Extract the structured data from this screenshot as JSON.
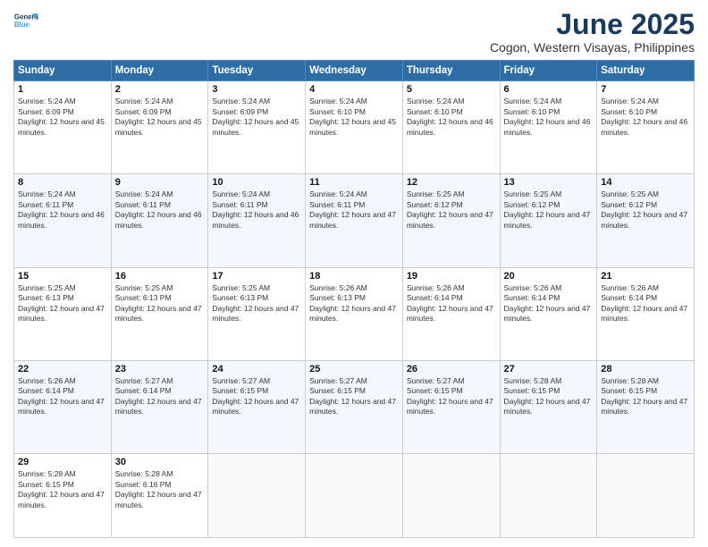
{
  "logo": {
    "line1": "General",
    "line2": "Blue"
  },
  "title": "June 2025",
  "subtitle": "Cogon, Western Visayas, Philippines",
  "weekdays": [
    "Sunday",
    "Monday",
    "Tuesday",
    "Wednesday",
    "Thursday",
    "Friday",
    "Saturday"
  ],
  "weeks": [
    [
      {
        "day": "1",
        "sunrise": "5:24 AM",
        "sunset": "6:09 PM",
        "daylight": "12 hours and 45 minutes."
      },
      {
        "day": "2",
        "sunrise": "5:24 AM",
        "sunset": "6:09 PM",
        "daylight": "12 hours and 45 minutes."
      },
      {
        "day": "3",
        "sunrise": "5:24 AM",
        "sunset": "6:09 PM",
        "daylight": "12 hours and 45 minutes."
      },
      {
        "day": "4",
        "sunrise": "5:24 AM",
        "sunset": "6:10 PM",
        "daylight": "12 hours and 45 minutes."
      },
      {
        "day": "5",
        "sunrise": "5:24 AM",
        "sunset": "6:10 PM",
        "daylight": "12 hours and 46 minutes."
      },
      {
        "day": "6",
        "sunrise": "5:24 AM",
        "sunset": "6:10 PM",
        "daylight": "12 hours and 46 minutes."
      },
      {
        "day": "7",
        "sunrise": "5:24 AM",
        "sunset": "6:10 PM",
        "daylight": "12 hours and 46 minutes."
      }
    ],
    [
      {
        "day": "8",
        "sunrise": "5:24 AM",
        "sunset": "6:11 PM",
        "daylight": "12 hours and 46 minutes."
      },
      {
        "day": "9",
        "sunrise": "5:24 AM",
        "sunset": "6:11 PM",
        "daylight": "12 hours and 46 minutes."
      },
      {
        "day": "10",
        "sunrise": "5:24 AM",
        "sunset": "6:11 PM",
        "daylight": "12 hours and 46 minutes."
      },
      {
        "day": "11",
        "sunrise": "5:24 AM",
        "sunset": "6:11 PM",
        "daylight": "12 hours and 47 minutes."
      },
      {
        "day": "12",
        "sunrise": "5:25 AM",
        "sunset": "6:12 PM",
        "daylight": "12 hours and 47 minutes."
      },
      {
        "day": "13",
        "sunrise": "5:25 AM",
        "sunset": "6:12 PM",
        "daylight": "12 hours and 47 minutes."
      },
      {
        "day": "14",
        "sunrise": "5:25 AM",
        "sunset": "6:12 PM",
        "daylight": "12 hours and 47 minutes."
      }
    ],
    [
      {
        "day": "15",
        "sunrise": "5:25 AM",
        "sunset": "6:13 PM",
        "daylight": "12 hours and 47 minutes."
      },
      {
        "day": "16",
        "sunrise": "5:25 AM",
        "sunset": "6:13 PM",
        "daylight": "12 hours and 47 minutes."
      },
      {
        "day": "17",
        "sunrise": "5:25 AM",
        "sunset": "6:13 PM",
        "daylight": "12 hours and 47 minutes."
      },
      {
        "day": "18",
        "sunrise": "5:26 AM",
        "sunset": "6:13 PM",
        "daylight": "12 hours and 47 minutes."
      },
      {
        "day": "19",
        "sunrise": "5:26 AM",
        "sunset": "6:14 PM",
        "daylight": "12 hours and 47 minutes."
      },
      {
        "day": "20",
        "sunrise": "5:26 AM",
        "sunset": "6:14 PM",
        "daylight": "12 hours and 47 minutes."
      },
      {
        "day": "21",
        "sunrise": "5:26 AM",
        "sunset": "6:14 PM",
        "daylight": "12 hours and 47 minutes."
      }
    ],
    [
      {
        "day": "22",
        "sunrise": "5:26 AM",
        "sunset": "6:14 PM",
        "daylight": "12 hours and 47 minutes."
      },
      {
        "day": "23",
        "sunrise": "5:27 AM",
        "sunset": "6:14 PM",
        "daylight": "12 hours and 47 minutes."
      },
      {
        "day": "24",
        "sunrise": "5:27 AM",
        "sunset": "6:15 PM",
        "daylight": "12 hours and 47 minutes."
      },
      {
        "day": "25",
        "sunrise": "5:27 AM",
        "sunset": "6:15 PM",
        "daylight": "12 hours and 47 minutes."
      },
      {
        "day": "26",
        "sunrise": "5:27 AM",
        "sunset": "6:15 PM",
        "daylight": "12 hours and 47 minutes."
      },
      {
        "day": "27",
        "sunrise": "5:28 AM",
        "sunset": "6:15 PM",
        "daylight": "12 hours and 47 minutes."
      },
      {
        "day": "28",
        "sunrise": "5:28 AM",
        "sunset": "6:15 PM",
        "daylight": "12 hours and 47 minutes."
      }
    ],
    [
      {
        "day": "29",
        "sunrise": "5:28 AM",
        "sunset": "6:15 PM",
        "daylight": "12 hours and 47 minutes."
      },
      {
        "day": "30",
        "sunrise": "5:28 AM",
        "sunset": "6:16 PM",
        "daylight": "12 hours and 47 minutes."
      },
      null,
      null,
      null,
      null,
      null
    ]
  ]
}
